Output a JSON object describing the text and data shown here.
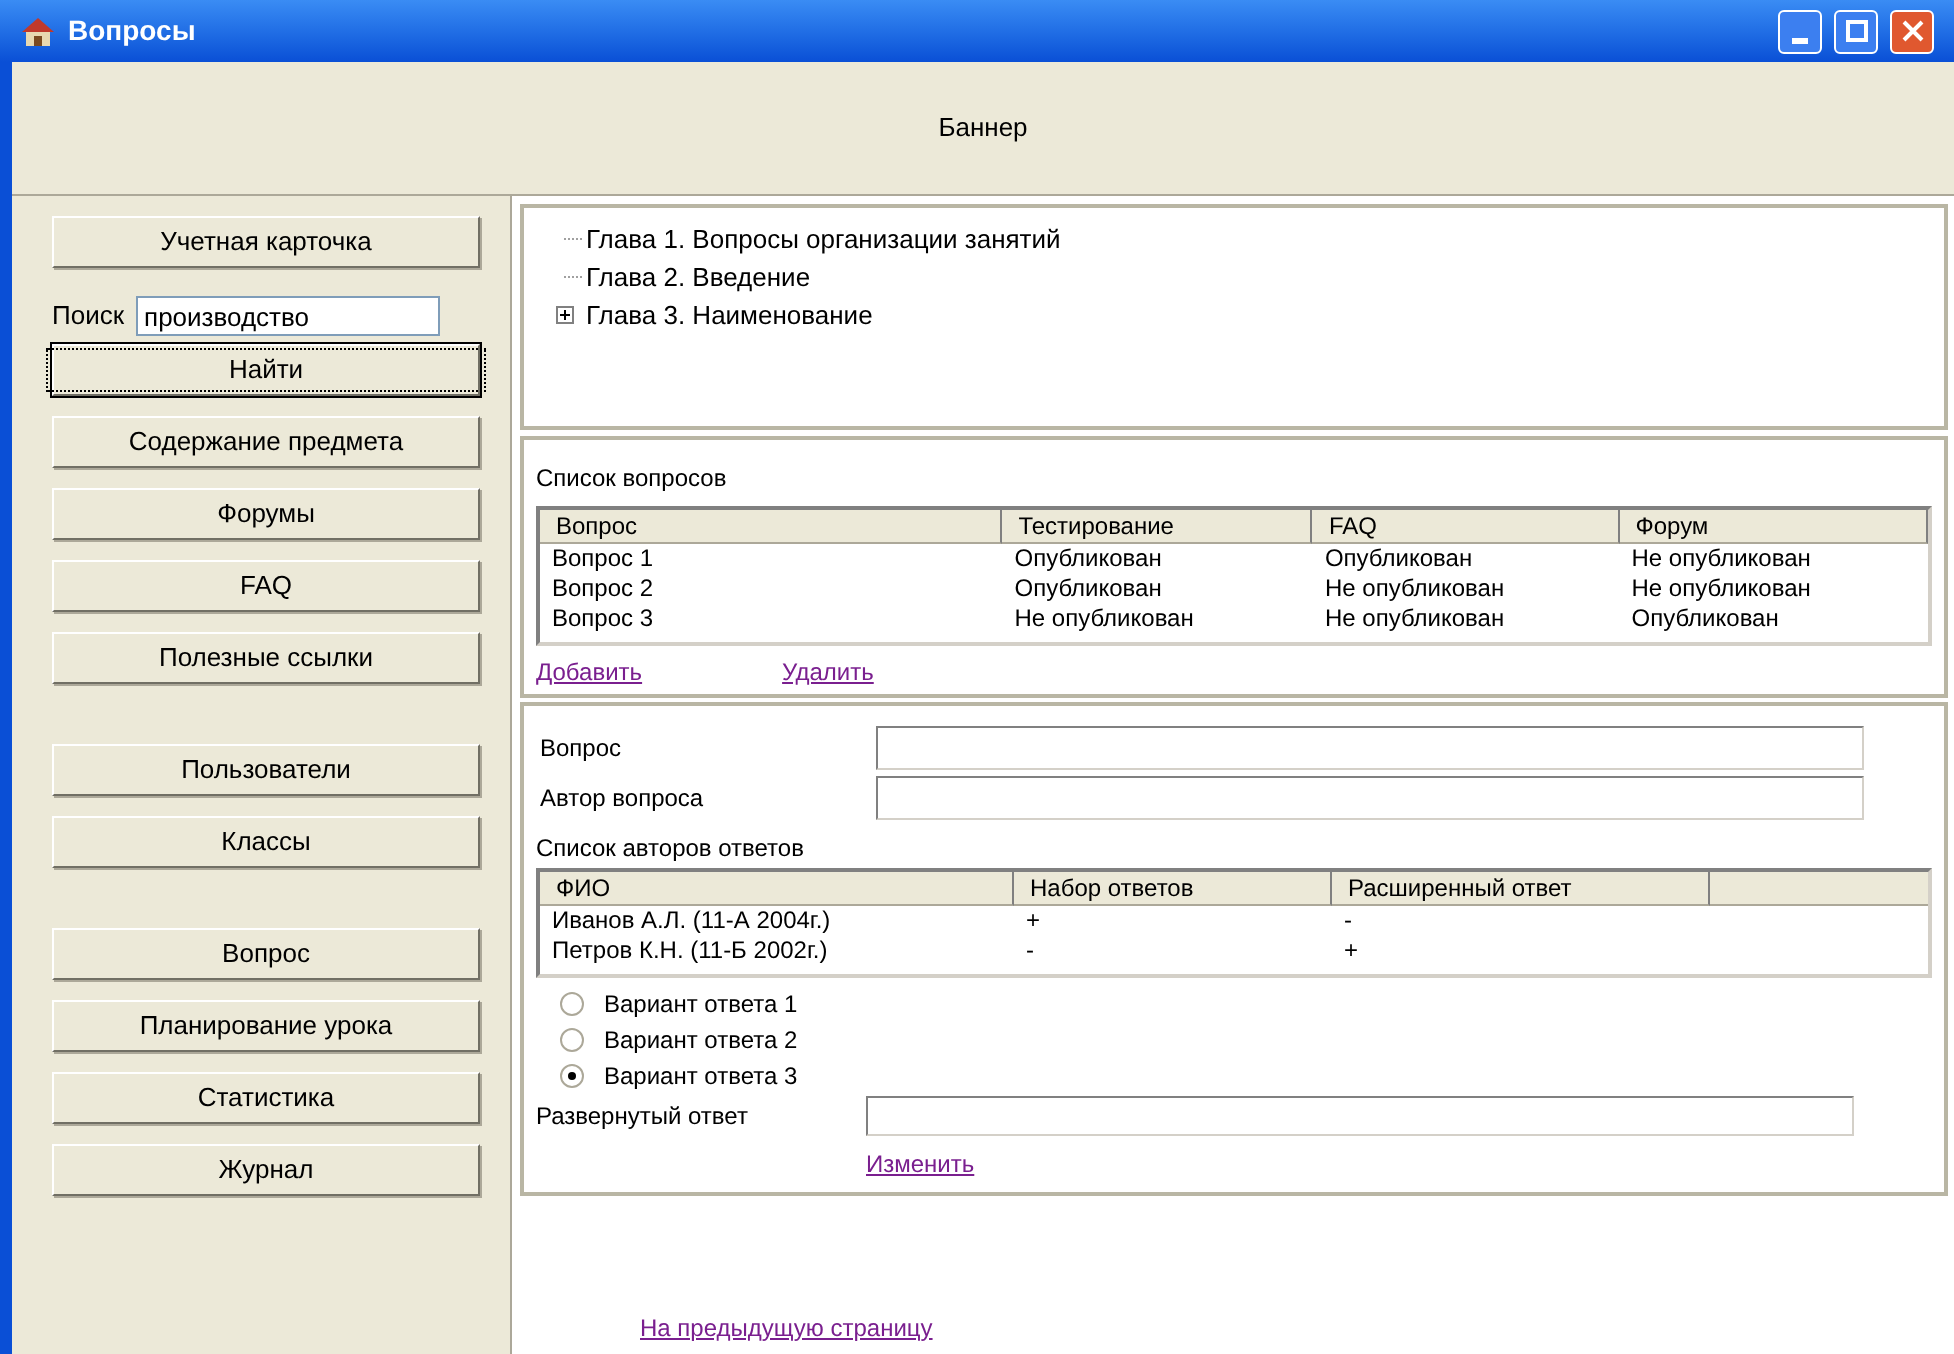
{
  "window": {
    "title": "Вопросы"
  },
  "banner": "Баннер",
  "sidebar": {
    "groups": [
      {
        "items": [
          {
            "kind": "button",
            "label": "Учетная карточка",
            "focused": false
          },
          {
            "kind": "search",
            "label": "Поиск",
            "value": "производство"
          },
          {
            "kind": "button",
            "label": "Найти",
            "focused": true
          },
          {
            "kind": "button",
            "label": "Содержание предмета",
            "focused": false
          },
          {
            "kind": "button",
            "label": "Форумы",
            "focused": false
          },
          {
            "kind": "button",
            "label": "FAQ",
            "focused": false
          },
          {
            "kind": "button",
            "label": "Полезные ссылки",
            "focused": false
          }
        ]
      },
      {
        "items": [
          {
            "kind": "button",
            "label": "Пользователи",
            "focused": false
          },
          {
            "kind": "button",
            "label": "Классы",
            "focused": false
          }
        ]
      },
      {
        "items": [
          {
            "kind": "button",
            "label": "Вопрос",
            "focused": false
          },
          {
            "kind": "button",
            "label": "Планирование урока",
            "focused": false
          },
          {
            "kind": "button",
            "label": "Статистика",
            "focused": false
          },
          {
            "kind": "button",
            "label": "Журнал",
            "focused": false
          }
        ]
      }
    ]
  },
  "tree": [
    {
      "kind": "leaf",
      "label": "Глава 1. Вопросы организации занятий"
    },
    {
      "kind": "leaf",
      "label": "Глава 2. Введение"
    },
    {
      "kind": "folder",
      "label": "Глава 3. Наименование",
      "expanded": false
    }
  ],
  "questions": {
    "title": "Список вопросов",
    "columns": [
      "Вопрос",
      "Тестирование",
      "FAQ",
      "Форум"
    ],
    "rows": [
      [
        "Вопрос 1",
        "Опубликован",
        "Опубликован",
        "Не опубликован"
      ],
      [
        "Вопрос 2",
        "Опубликован",
        "Не опубликован",
        "Не опубликован"
      ],
      [
        "Вопрос 3",
        "Не опубликован",
        "Не опубликован",
        "Опубликован"
      ]
    ],
    "links": [
      "Добавить",
      "Удалить"
    ]
  },
  "detail": {
    "fields": [
      {
        "label": "Вопрос"
      },
      {
        "label": "Автор вопроса"
      }
    ],
    "authors_title": "Список авторов ответов",
    "authors_columns": [
      "ФИО",
      "Набор ответов",
      "Расширенный ответ"
    ],
    "authors_rows": [
      [
        "Иванов А.Л. (11-А 2004г.)",
        "+",
        "-"
      ],
      [
        "Петров К.Н. (11-Б 2002г.)",
        "-",
        "+"
      ]
    ],
    "options": [
      {
        "label": "Вариант ответа 1",
        "selected": false
      },
      {
        "label": "Вариант ответа 2",
        "selected": false
      },
      {
        "label": "Вариант ответа 3",
        "selected": true
      }
    ],
    "answer_label": "Развернутый ответ",
    "change_link": "Изменить"
  },
  "back_link": "На предыдущую страницу"
}
